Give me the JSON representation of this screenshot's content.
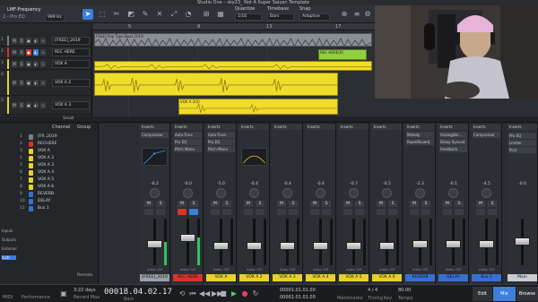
{
  "window": {
    "title": "Studio One – sky23_ Not A Super Saiyan Template"
  },
  "toolbar": {
    "preset_name": "LMF-Frequency",
    "preset_sub": "2 - Pro EQ",
    "freq_value": "999 Hz",
    "quantize_label": "Quantize",
    "quantize_value": "1/16",
    "timebase_label": "Timebase",
    "timebase_value": "Bars",
    "snap_label": "Snap",
    "snap_value": "Adaptive"
  },
  "tracks": [
    {
      "num": "1",
      "name": "[FREE]_2019",
      "color": "#7a7f86"
    },
    {
      "num": "2",
      "name": "REC HERE",
      "color": "#d8342c"
    },
    {
      "num": "3",
      "name": "VOX A",
      "color": "#e6d229"
    },
    {
      "num": "4",
      "name": "VOX A 2",
      "color": "#e6d229"
    },
    {
      "num": "5",
      "name": "VOX A 3",
      "color": "#e6d229"
    }
  ],
  "ruler": {
    "marks": [
      "5",
      "9",
      "13",
      "17"
    ]
  },
  "clips": {
    "beat_label": "FREE] Pop Type Beat 2019",
    "rec_label": "REC HERE(0)",
    "vox_label": "VOX A",
    "vox2_label": "VOX A 2(0)"
  },
  "arrange_bottom": {
    "size_label": "Small"
  },
  "console_left": {
    "col_channel": "Channel",
    "col_group": "Group",
    "instruments_label": "Instruments",
    "side_buttons": [
      "Inputs",
      "Outputs",
      "External",
      "Instr"
    ],
    "remote_label": "Remote",
    "channels": [
      {
        "num": "1",
        "name": "[FR..2019",
        "color": "#7a7f86"
      },
      {
        "num": "2",
        "name": "RECHERE",
        "color": "#d8342c"
      },
      {
        "num": "3",
        "name": "VOX A",
        "color": "#e6d229"
      },
      {
        "num": "4",
        "name": "VOX A 2",
        "color": "#e6d229"
      },
      {
        "num": "5",
        "name": "VOX A 3",
        "color": "#e6d229"
      },
      {
        "num": "6",
        "name": "VOX A 4",
        "color": "#e6d229"
      },
      {
        "num": "7",
        "name": "VOX A 5",
        "color": "#e6d229"
      },
      {
        "num": "8",
        "name": "VOX A 6",
        "color": "#e6d229"
      },
      {
        "num": "9",
        "name": "REVERB",
        "color": "#3a6fd0"
      },
      {
        "num": "10",
        "name": "DELAY",
        "color": "#3a6fd0"
      },
      {
        "num": "11",
        "name": "Bus 1",
        "color": "#3a6fd0"
      }
    ]
  },
  "strips": [
    {
      "header": "Inserts",
      "inserts": [
        "Compressor",
        "",
        ""
      ],
      "value": "-6.2",
      "name": "[FREE]_2019",
      "color": "#9aa0a8",
      "auto": "Auto: Off",
      "meter": 0.5,
      "fader": 0.45
    },
    {
      "header": "Inserts",
      "inserts": [
        "Auto-Tune",
        "Pro EQ",
        "Pitch Mono"
      ],
      "value": "-0.0",
      "name": "REC HERE",
      "color": "#d8342c",
      "auto": "Auto: Off",
      "meter": 0.6,
      "fader": 0.6
    },
    {
      "header": "Inserts",
      "inserts": [
        "Auto-Tune",
        "Pro EQ",
        "Pitch Mono"
      ],
      "value": "-5.0",
      "name": "VOX A",
      "color": "#e6d229",
      "auto": "Auto: Off",
      "meter": 0.0,
      "fader": 0.4
    },
    {
      "header": "Inserts",
      "inserts": [
        "",
        "",
        ""
      ],
      "value": "-0.4",
      "name": "VOX A 2",
      "color": "#e6d229",
      "auto": "Auto: Off",
      "meter": 0.0,
      "fader": 0.4
    },
    {
      "header": "Inserts",
      "inserts": [
        "",
        "",
        ""
      ],
      "value": "-0.4",
      "name": "VOX A 3",
      "color": "#e6d229",
      "auto": "Auto: Off",
      "meter": 0.0,
      "fader": 0.4
    },
    {
      "header": "Inserts",
      "inserts": [
        "",
        "",
        ""
      ],
      "value": "-0.4",
      "name": "VOX A 4",
      "color": "#e6d229",
      "auto": "Auto: Off",
      "meter": 0.0,
      "fader": 0.4
    },
    {
      "header": "Inserts",
      "inserts": [
        "",
        "",
        ""
      ],
      "value": "-0.7",
      "name": "VOX A 5",
      "color": "#e6d229",
      "auto": "Auto: Off",
      "meter": 0.0,
      "fader": 0.4
    },
    {
      "header": "Inserts",
      "inserts": [
        "",
        "",
        ""
      ],
      "value": "-0.5",
      "name": "VOX A 6",
      "color": "#e6d229",
      "auto": "Auto: Off",
      "meter": 0.0,
      "fader": 0.4
    },
    {
      "header": "Inserts",
      "inserts": [
        "Melody",
        "RoomReverb",
        ""
      ],
      "value": "-2.3",
      "name": "REVERB",
      "color": "#3a6fd0",
      "auto": "Auto: Off",
      "meter": 0.0,
      "fader": 0.45
    },
    {
      "header": "Inserts",
      "inserts": [
        "AnalogDel...",
        "Delay Synced",
        "Feedback"
      ],
      "value": "-0.1",
      "name": "DELAY",
      "color": "#3a6fd0",
      "auto": "Auto: Off",
      "meter": 0.0,
      "fader": 0.45
    },
    {
      "header": "Inserts",
      "inserts": [
        "Compressor",
        "",
        ""
      ],
      "value": "-4.5",
      "name": "Bus 1",
      "color": "#3a6fd0",
      "auto": "Auto: Off",
      "meter": 0.0,
      "fader": 0.45
    }
  ],
  "main_strip": {
    "header": "Inserts",
    "inserts": [
      "Pro EQ",
      "Limiter",
      "Post"
    ],
    "name": "Main",
    "color": "#c9ccd1",
    "value": "-0.0"
  },
  "transport": {
    "midi_label": "MIDI",
    "perf_label": "Performance",
    "days_value": "3:22 days",
    "days_label": "Record Max",
    "time_value": "00018.04.02.17",
    "time_label": "Bars",
    "loop_start": "00001.01.01.00",
    "loop_end": "00001.01.01.00",
    "metronome_label": "Metronome",
    "signature": "4 / 4",
    "timing_label": "Timing",
    "key_label": "Key",
    "tempo_value": "80.00",
    "tempo_label": "Tempo",
    "edit_label": "Edit",
    "mix_label": "Mix",
    "browse_label": "Browse"
  }
}
